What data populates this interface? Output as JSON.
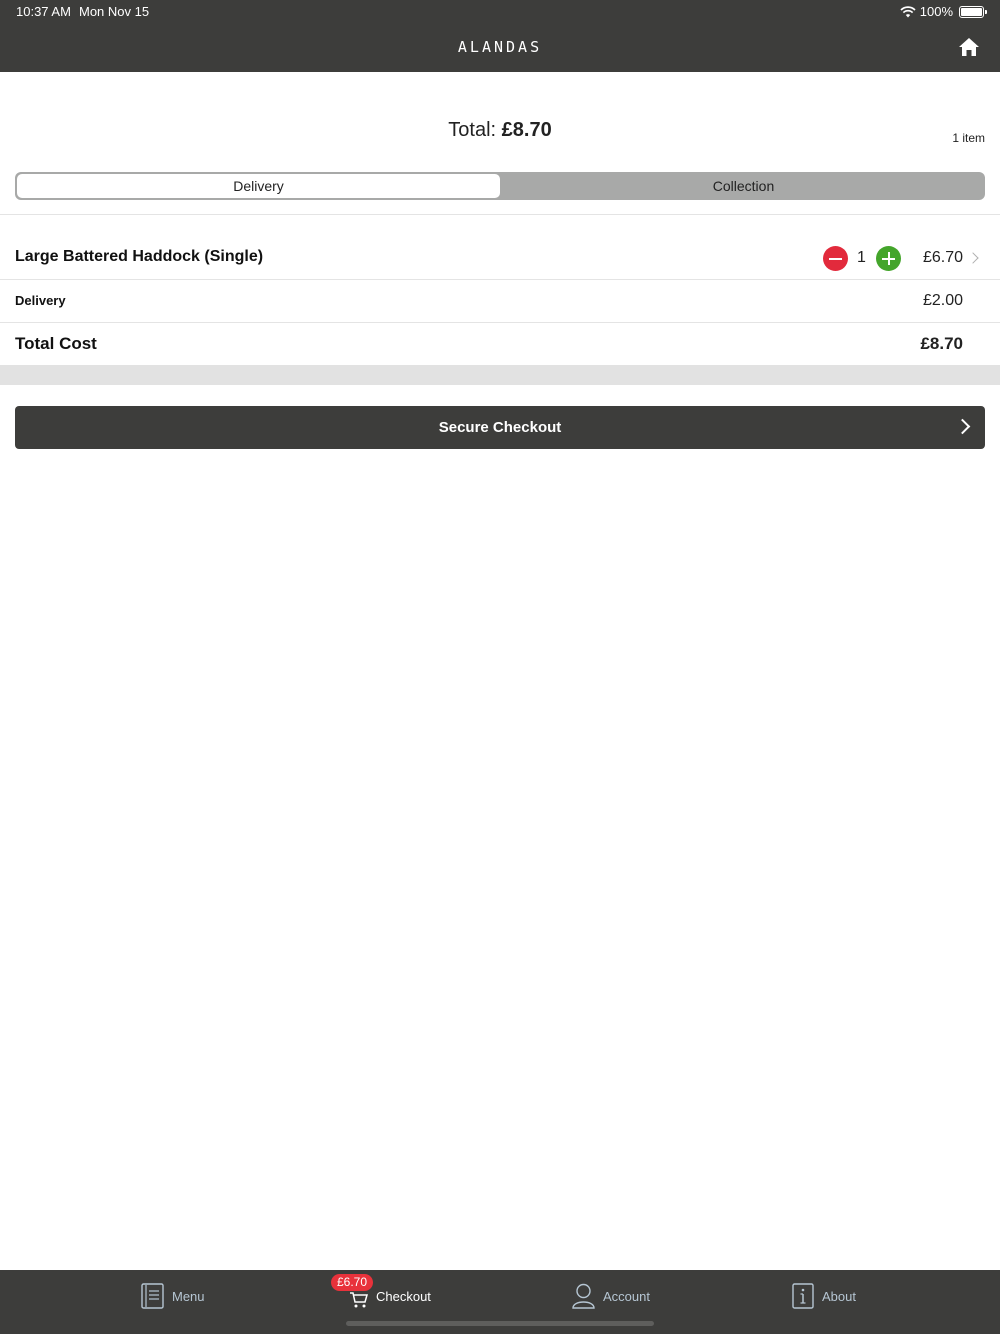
{
  "status_bar": {
    "time": "10:37 AM",
    "date": "Mon Nov 15",
    "battery": "100%"
  },
  "header": {
    "brand": "ALANDAS",
    "home_icon": "home-icon"
  },
  "summary": {
    "total_label": "Total:",
    "total_value": "£8.70",
    "item_count": "1 item"
  },
  "order_type": {
    "options": [
      "Delivery",
      "Collection"
    ],
    "selected": "Delivery"
  },
  "line_items": [
    {
      "name": "Large Battered Haddock (Single)",
      "quantity": "1",
      "price": "£6.70"
    }
  ],
  "delivery": {
    "label": "Delivery",
    "value": "£2.00"
  },
  "total_cost": {
    "label": "Total Cost",
    "value": "£8.70"
  },
  "checkout": {
    "label": "Secure Checkout"
  },
  "tabs": [
    {
      "label": "Menu",
      "icon": "menu-book-icon"
    },
    {
      "label": "Checkout",
      "icon": "cart-icon",
      "badge": "£6.70",
      "active": true
    },
    {
      "label": "Account",
      "icon": "person-icon"
    },
    {
      "label": "About",
      "icon": "info-icon"
    }
  ],
  "colors": {
    "bar": "#3d3d3b",
    "minus": "#e22a3c",
    "plus": "#44a52b",
    "badge": "#e8323b",
    "tab_inactive": "#b6c6d3"
  }
}
